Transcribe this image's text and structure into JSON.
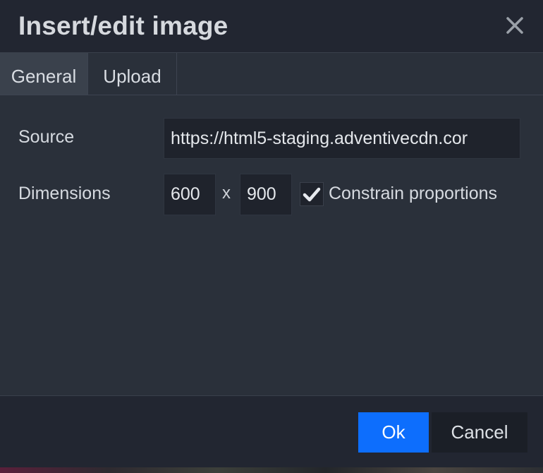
{
  "dialog": {
    "title": "Insert/edit image"
  },
  "tabs": [
    {
      "label": "General",
      "active": true
    },
    {
      "label": "Upload",
      "active": false
    }
  ],
  "form": {
    "source_label": "Source",
    "source_value": "https://html5-staging.adventivecdn.cor",
    "dimensions_label": "Dimensions",
    "width_value": "600",
    "separator": "x",
    "height_value": "900",
    "constrain_label": "Constrain proportions",
    "constrain_checked": true
  },
  "footer": {
    "ok_label": "Ok",
    "cancel_label": "Cancel"
  },
  "colors": {
    "primary": "#0d6efd",
    "panel": "#2a303a",
    "header": "#222631"
  },
  "icons": {
    "close": "close-icon",
    "check": "checkmark-icon"
  }
}
